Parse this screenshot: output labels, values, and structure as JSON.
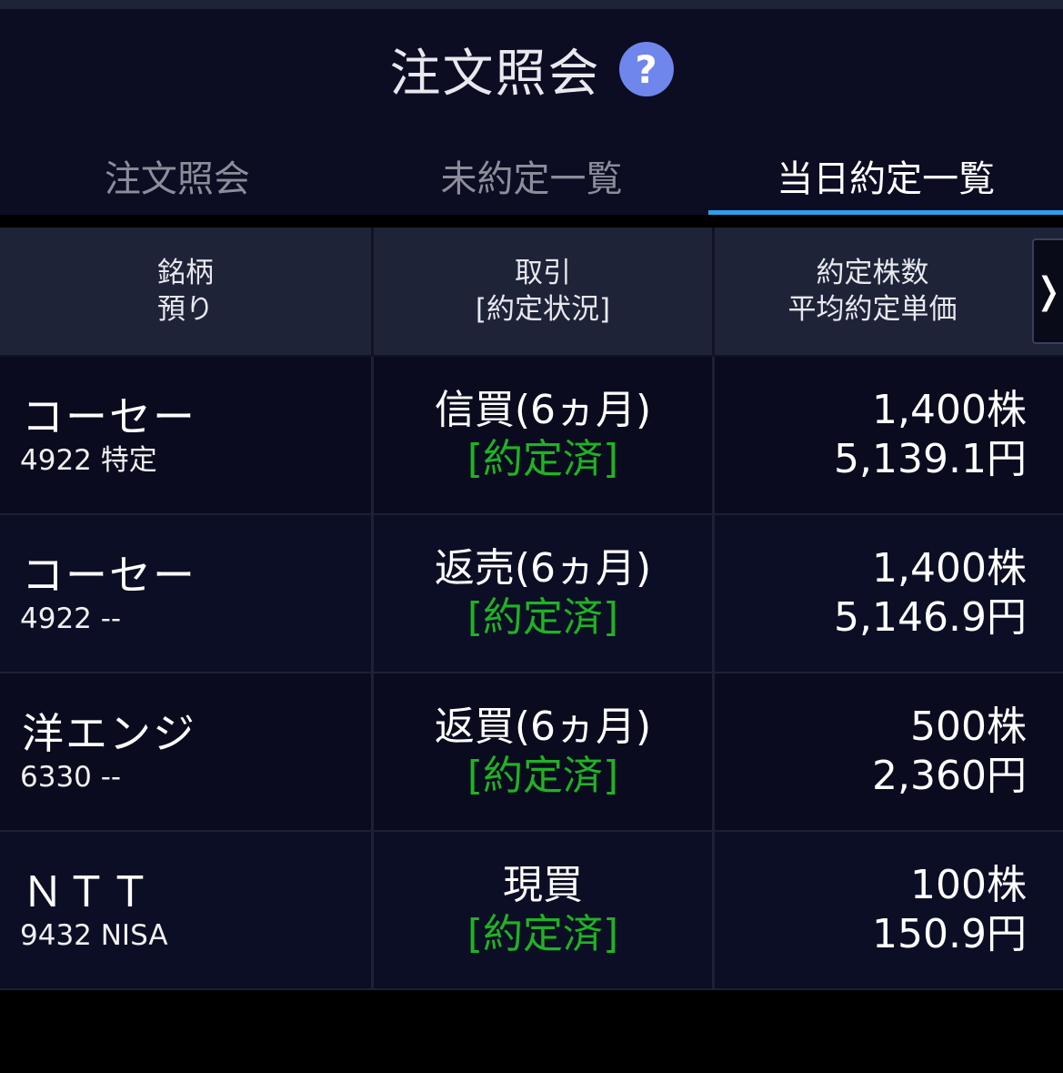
{
  "header": {
    "title": "注文照会",
    "help_icon": "?"
  },
  "tabs": [
    {
      "label": "注文照会",
      "active": false
    },
    {
      "label": "未約定一覧",
      "active": false
    },
    {
      "label": "当日約定一覧",
      "active": true
    }
  ],
  "table": {
    "columns": [
      {
        "line1": "銘柄",
        "line2": "預り"
      },
      {
        "line1": "取引",
        "line2": "[約定状況]"
      },
      {
        "line1": "約定株数",
        "line2": "平均約定単価"
      }
    ],
    "scroll_icon": "❭",
    "rows": [
      {
        "name": "コーセー",
        "code": "4922 特定",
        "trade": "信買(6ヵ月)",
        "status": "[約定済]",
        "qty": "1,400株",
        "price": "5,139.1円"
      },
      {
        "name": "コーセー",
        "code": "4922 --",
        "trade": "返売(6ヵ月)",
        "status": "[約定済]",
        "qty": "1,400株",
        "price": "5,146.9円"
      },
      {
        "name": "洋エンジ",
        "code": "6330 --",
        "trade": "返買(6ヵ月)",
        "status": "[約定済]",
        "qty": "500株",
        "price": "2,360円"
      },
      {
        "name": "ＮＴＴ",
        "code": "9432 NISA",
        "trade": "現買",
        "status": "[約定済]",
        "qty": "100株",
        "price": "150.9円"
      }
    ]
  },
  "colors": {
    "background": "#0c0d23",
    "header_row": "#1e2338",
    "active_tab_underline": "#2ca0e8",
    "status_green": "#1fb324",
    "help_icon": "#6f86ec"
  }
}
